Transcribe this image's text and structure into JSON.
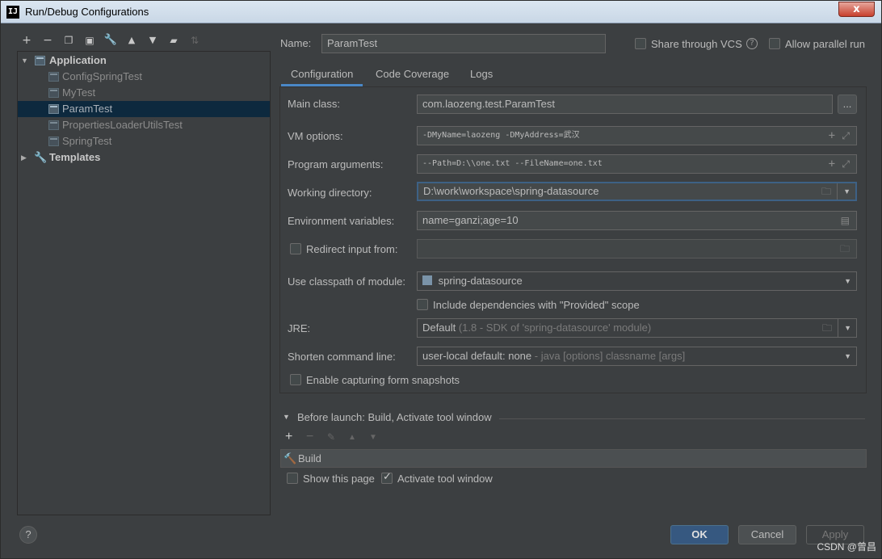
{
  "window": {
    "title": "Run/Debug Configurations",
    "app_icon": "IJ",
    "close": "x"
  },
  "tree": {
    "root": "Application",
    "children": [
      "ConfigSpringTest",
      "MyTest",
      "ParamTest",
      "PropertiesLoaderUtilsTest",
      "SpringTest"
    ],
    "templates": "Templates"
  },
  "name_label": "Name:",
  "name_value": "ParamTest",
  "share_vcs": "Share through VCS",
  "allow_parallel": "Allow parallel run",
  "tabs": [
    "Configuration",
    "Code Coverage",
    "Logs"
  ],
  "form": {
    "main_class_label": "Main class:",
    "main_class": "com.laozeng.test.ParamTest",
    "browse": "...",
    "vm_label": "VM options:",
    "vm": "-DMyName=laozeng -DMyAddress=武汉",
    "prog_label": "Program arguments:",
    "prog": "--Path=D:\\\\one.txt --FileName=one.txt",
    "wd_label": "Working directory:",
    "wd": "D:\\work\\workspace\\spring-datasource",
    "env_label": "Environment variables:",
    "env": "name=ganzi;age=10",
    "redirect_label": "Redirect input from:",
    "classpath_label": "Use classpath of module:",
    "classpath": "spring-datasource",
    "include_deps": "Include dependencies with \"Provided\" scope",
    "jre_label": "JRE:",
    "jre_main": "Default",
    "jre_detail": "(1.8 - SDK of 'spring-datasource' module)",
    "shorten_label": "Shorten command line:",
    "shorten_main": "user-local default: none",
    "shorten_detail": "- java [options] classname [args]",
    "capture_snapshots": "Enable capturing form snapshots"
  },
  "before_launch": {
    "title": "Before launch: Build, Activate tool window",
    "build": "Build",
    "show_page": "Show this page",
    "activate": "Activate tool window"
  },
  "buttons": {
    "ok": "OK",
    "cancel": "Cancel",
    "apply": "Apply",
    "help": "?"
  },
  "watermark": "CSDN @曾昌",
  "colors": {
    "selection": "#0d293e",
    "ok": "#365880",
    "focus": "#3d6185",
    "bg": "#3c3f41"
  }
}
